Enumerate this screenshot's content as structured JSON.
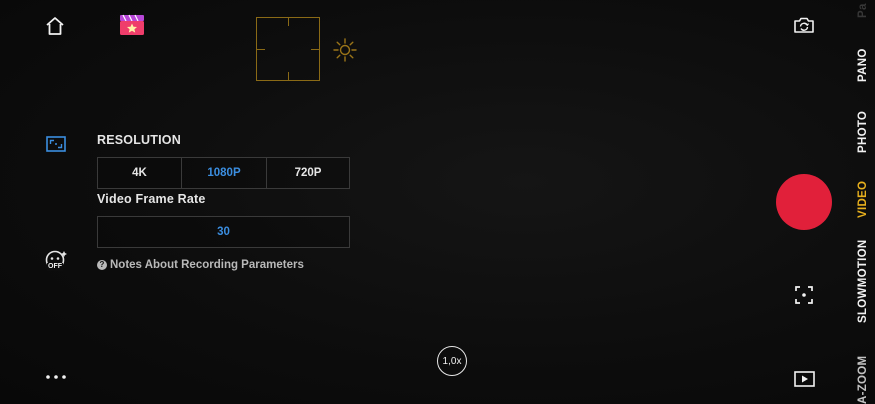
{
  "top_left": {
    "home_icon": "home-icon",
    "app_icon": "movie-clapper-star-icon"
  },
  "focus": {
    "exposure_icon": "sun-icon",
    "focus_color": "#8a6a16"
  },
  "left_toolbar": {
    "resolution_icon": "resolution-settings-icon",
    "beauty_icon": "beauty-face-icon",
    "beauty_state": "OFF",
    "more_icon": "more-dots-icon"
  },
  "settings": {
    "resolution": {
      "title": "RESOLUTION",
      "options": [
        "4K",
        "1080P",
        "720P"
      ],
      "selected": "1080P"
    },
    "frame_rate": {
      "title": "Video Frame Rate",
      "options": [
        "30"
      ],
      "selected": "30"
    },
    "notes_label": "Notes About Recording Parameters",
    "selected_color": "#3b8ee0"
  },
  "zoom": {
    "label": "1,0x"
  },
  "right_controls": {
    "switch_camera_icon": "switch-camera-icon",
    "shutter_color": "#e1203a",
    "scan_icon": "focus-frame-icon",
    "gallery_icon": "play-gallery-icon"
  },
  "modes": {
    "items": [
      "Pa",
      "PANO",
      "PHOTO",
      "VIDEO",
      "SLOWMOTION",
      "A-ZOOM"
    ],
    "active": "VIDEO",
    "active_color": "#e9b11d"
  }
}
